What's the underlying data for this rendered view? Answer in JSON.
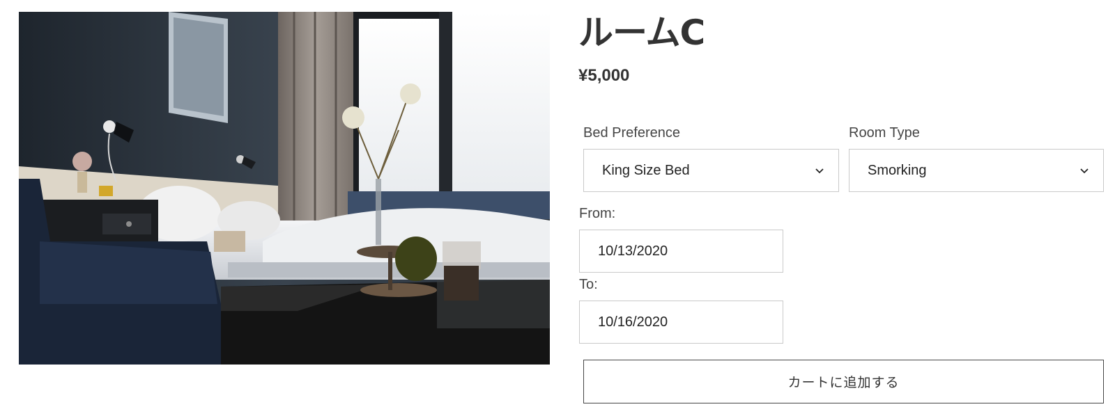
{
  "product": {
    "image_alt": "hotel room photo",
    "title": "ルームC",
    "price": "¥5,000"
  },
  "options": {
    "bed_preference": {
      "label": "Bed Preference",
      "value": "King Size Bed"
    },
    "room_type": {
      "label": "Room Type",
      "value": "Smorking"
    }
  },
  "dates": {
    "from": {
      "label": "From:",
      "value": "10/13/2020"
    },
    "to": {
      "label": "To:",
      "value": "10/16/2020"
    }
  },
  "cart": {
    "add_label": "カートに追加する"
  },
  "icons": {
    "select_arrow": "chevron-down-icon"
  }
}
